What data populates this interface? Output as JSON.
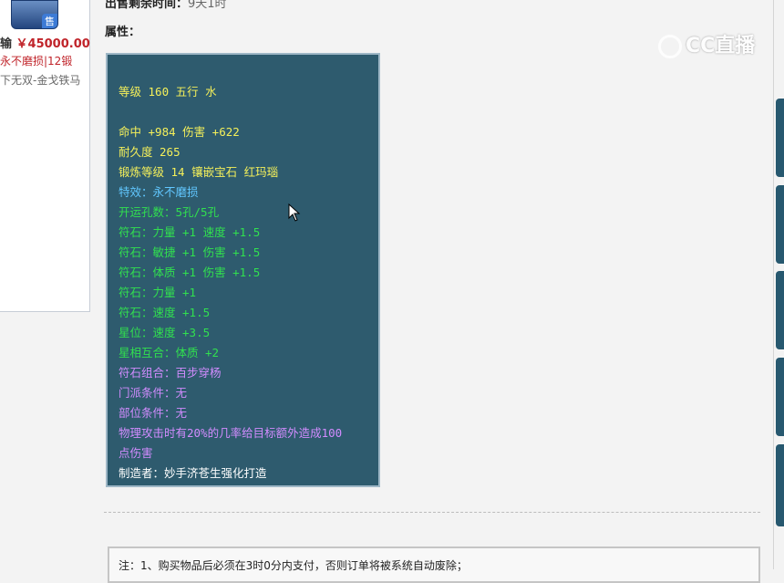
{
  "left_card": {
    "sell_badge": "售",
    "price_label": "输",
    "price": "￥45000.00",
    "tag": "永不磨损|12锻",
    "server": "下无双-金戈铁马"
  },
  "main": {
    "remaining_label": "出售剩余时间：",
    "remaining_value": "9天1时",
    "attr_title": "属性："
  },
  "attributes": [
    {
      "text": "等级 160 五行 水",
      "color": "yellow"
    },
    {
      "text": "",
      "color": "gap"
    },
    {
      "text": "命中 +984 伤害 +622",
      "color": "yellow"
    },
    {
      "text": "耐久度 265",
      "color": "yellow"
    },
    {
      "text": "锻炼等级 14 镶嵌宝石 红玛瑙",
      "color": "yellow"
    },
    {
      "text": "特效：永不磨损",
      "color": "blue"
    },
    {
      "text": "开运孔数：5孔/5孔",
      "color": "green"
    },
    {
      "text": "符石：力量 +1 速度 +1.5",
      "color": "green"
    },
    {
      "text": "符石：敏捷 +1 伤害 +1.5",
      "color": "green"
    },
    {
      "text": "符石：体质 +1 伤害 +1.5",
      "color": "green"
    },
    {
      "text": "符石：力量 +1",
      "color": "green"
    },
    {
      "text": "符石：速度 +1.5",
      "color": "green"
    },
    {
      "text": "星位：速度 +3.5",
      "color": "green"
    },
    {
      "text": "星相互合：体质 +2",
      "color": "green"
    },
    {
      "text": "符石组合：百步穿杨",
      "color": "purple"
    },
    {
      "text": "门派条件：无",
      "color": "purple"
    },
    {
      "text": "部位条件：无",
      "color": "purple"
    },
    {
      "text": "物理攻击时有20%的几率给目标额外造成100",
      "color": "purple"
    },
    {
      "text": "点伤害",
      "color": "purple"
    },
    {
      "text": "制造者：妙手济苍生强化打造",
      "color": "white"
    }
  ],
  "watermark": "CC直播",
  "note": "注：1、购买物品后必须在3时0分内支付，否则订单将被系统自动废除；",
  "colors": {
    "attr_bg": "#2e5b6e",
    "yellow": "#f5f05a",
    "blue": "#61c7ff",
    "green": "#31e04f",
    "purple": "#d28cff",
    "price_red": "#c0242a"
  }
}
